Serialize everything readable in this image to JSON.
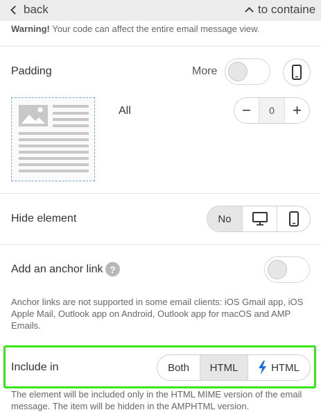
{
  "topbar": {
    "back_label": "back",
    "collapse_label": "to containe"
  },
  "warning": {
    "bold": "Warning!",
    "text": " Your code can affect the entire email message view."
  },
  "padding": {
    "label": "Padding",
    "more_label": "More",
    "more_enabled": false,
    "side_label": "All",
    "value": "0",
    "minus": "−",
    "plus": "+"
  },
  "hide_element": {
    "label": "Hide element",
    "options": [
      "No",
      "desktop-icon",
      "mobile-icon"
    ],
    "selected": "No"
  },
  "anchor": {
    "label": "Add an anchor link",
    "help": "?",
    "enabled": false,
    "note": "Anchor links are not supported in some email clients: iOS Gmail app, iOS Apple Mail, Outlook app on Android, Outlook app for macOS and AMP Emails."
  },
  "include_in": {
    "label": "Include in",
    "options": {
      "both": "Both",
      "html": "HTML",
      "amp": "HTML"
    },
    "selected": "HTML",
    "note": "The element will be included only in the HTML MIME version of the email message. The item will be hidden in the AMPHTML version."
  },
  "colors": {
    "highlight": "#39e619",
    "amp_bolt": "#1a6fe0",
    "preview_border": "#7aa6d0"
  }
}
